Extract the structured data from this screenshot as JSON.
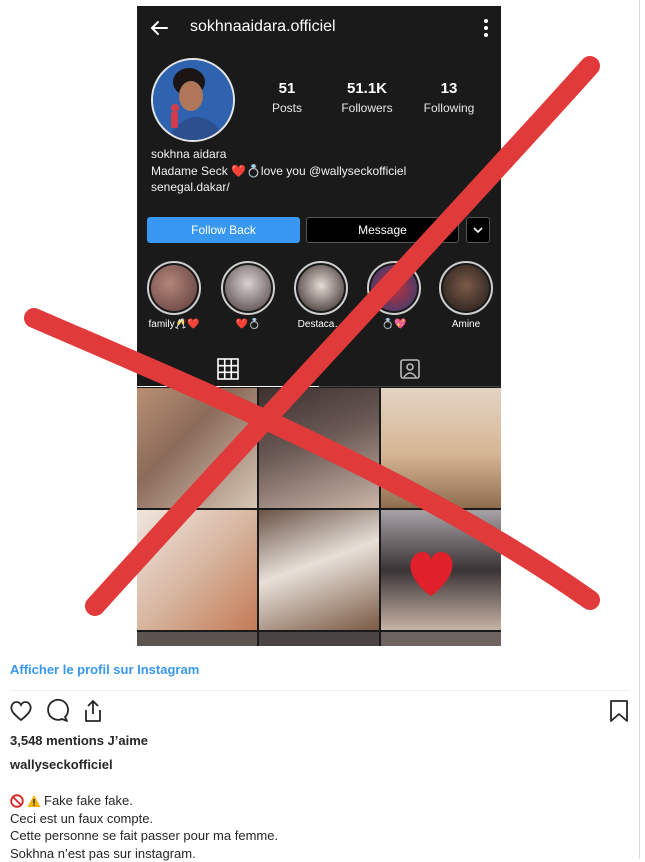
{
  "profile": {
    "username": "sokhnaaidara.officiel",
    "stats": [
      {
        "value": "51",
        "label": "Posts"
      },
      {
        "value": "51.1K",
        "label": "Followers"
      },
      {
        "value": "13",
        "label": "Following"
      }
    ],
    "bio": {
      "name": "sokhna aidara",
      "line2": "Madame Seck ❤️💍love you @wallyseckofficiel",
      "line3": "senegal.dakar/"
    },
    "buttons": {
      "follow": "Follow Back",
      "message": "Message"
    },
    "highlights": [
      "family🥂❤️",
      "❤️💍",
      "Destaca…",
      "💍💖",
      "Amine"
    ]
  },
  "post": {
    "view_profile_link": "Afficher le profil sur Instagram",
    "likes_text": "3,548 mentions J’aime",
    "owner": "wallyseckofficiel",
    "caption_first": "Fake fake fake.",
    "caption_lines": [
      "Ceci est un faux compte.",
      "Cette personne se fait passer pour ma femme.",
      "Sokhna n’est pas sur instagram."
    ]
  },
  "colors": {
    "accent": "#3897f0",
    "cross": "#e03a3a",
    "screenshot_bg": "#1a1a1a"
  },
  "icons": [
    "back-arrow-icon",
    "more-vertical-icon",
    "grid-icon",
    "tagged-icon",
    "heart-icon",
    "comment-icon",
    "share-icon",
    "bookmark-icon",
    "prohibited-icon",
    "warning-icon"
  ]
}
